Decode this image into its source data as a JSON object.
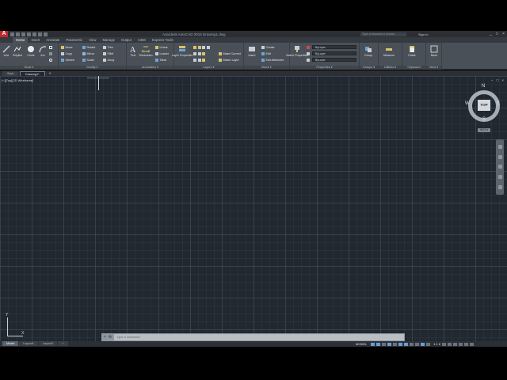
{
  "title_bar": {
    "logo": "A",
    "title": "Autodesk AutoCAD 2015   Drawing1.dwg",
    "search_placeholder": "Type a keyword or phrase",
    "signin": "Sign In",
    "controls": [
      "_",
      "□",
      "×"
    ]
  },
  "ribbon_tabs": [
    "Home",
    "Insert",
    "Annotate",
    "Parametric",
    "View",
    "Manage",
    "Output",
    "A360",
    "Express Tools"
  ],
  "ribbon": {
    "draw": {
      "label": "Draw ▾",
      "line": "Line",
      "polyline": "Polyline",
      "circle": "Circle",
      "arc": "Arc"
    },
    "modify": {
      "label": "Modify ▾",
      "move": "Move",
      "rotate": "Rotate",
      "trim": "Trim",
      "copy": "Copy",
      "mirror": "Mirror",
      "fillet": "Fillet",
      "stretch": "Stretch",
      "scale": "Scale",
      "array": "Array"
    },
    "annotation": {
      "label": "Annotation ▾",
      "text": "Text",
      "dimension": "Dimension",
      "linear": "Linear",
      "leader": "Leader",
      "table": "Table"
    },
    "layers": {
      "label": "Layers ▾",
      "layer_properties": "Layer Properties",
      "make_current": "Make Current",
      "match_layer": "Match Layer"
    },
    "block": {
      "label": "Block ▾",
      "insert": "Insert",
      "create": "Create",
      "edit": "Edit",
      "edit_attributes": "Edit Attributes"
    },
    "properties": {
      "label": "Properties ▾",
      "match_properties": "Match Properties",
      "bylayer1": "ByLayer",
      "bylayer2": "ByLayer",
      "bylayer3": "ByLayer"
    },
    "groups": {
      "label": "Groups ▾",
      "group": "Group"
    },
    "utilities": {
      "label": "Utilities ▾",
      "measure": "Measure"
    },
    "clipboard": {
      "label": "Clipboard",
      "paste": "Paste"
    },
    "view": {
      "label": "View ▾",
      "base": "Base"
    }
  },
  "file_tabs": {
    "start": "Start",
    "drawing": "Drawing1*",
    "add": "+"
  },
  "viewport": {
    "label": "[−][Top][2D Wireframe]",
    "controls": [
      "−",
      "□",
      "×"
    ]
  },
  "viewcube": {
    "top": "TOP",
    "n": "N",
    "s": "S",
    "e": "E",
    "w": "W",
    "wcs": "WCS ▾"
  },
  "ucs": {
    "x": "X",
    "y": "Y"
  },
  "command_line": {
    "placeholder": "Type a command",
    "btn_close": "×",
    "btn_custom": "⚙"
  },
  "layout_tabs": [
    "Model",
    "Layout1",
    "Layout2",
    "+"
  ],
  "status_bar": {
    "model": "MODEL",
    "scale": "1:1 ▾"
  },
  "colors": {
    "canvas": "#212830",
    "ribbon": "#4a5058",
    "accent_red": "#c0282d",
    "status_blue": "#6b9bd0"
  }
}
